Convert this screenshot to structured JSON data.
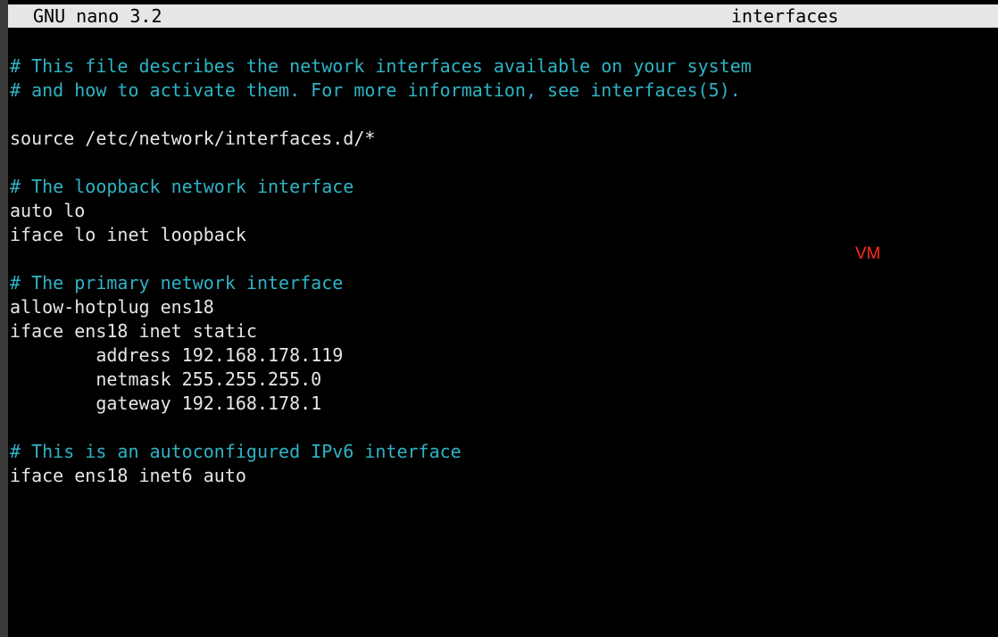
{
  "editor": {
    "app_version": "GNU nano 3.2",
    "file_name": "interfaces"
  },
  "buffer": {
    "lines": [
      {
        "text": "# This file describes the network interfaces available on your system",
        "kind": "comment"
      },
      {
        "text": "# and how to activate them. For more information, see interfaces(5).",
        "kind": "comment"
      },
      {
        "text": "",
        "kind": "code"
      },
      {
        "text": "source /etc/network/interfaces.d/*",
        "kind": "code"
      },
      {
        "text": "",
        "kind": "code"
      },
      {
        "text": "# The loopback network interface",
        "kind": "comment"
      },
      {
        "text": "auto lo",
        "kind": "code"
      },
      {
        "text": "iface lo inet loopback",
        "kind": "code"
      },
      {
        "text": "",
        "kind": "code"
      },
      {
        "text": "# The primary network interface",
        "kind": "comment"
      },
      {
        "text": "allow-hotplug ens18",
        "kind": "code"
      },
      {
        "text": "iface ens18 inet static",
        "kind": "code"
      },
      {
        "text": "        address 192.168.178.119",
        "kind": "code"
      },
      {
        "text": "        netmask 255.255.255.0",
        "kind": "code"
      },
      {
        "text": "        gateway 192.168.178.1",
        "kind": "code"
      },
      {
        "text": "",
        "kind": "code"
      },
      {
        "text": "# This is an autoconfigured IPv6 interface",
        "kind": "comment"
      },
      {
        "text": "iface ens18 inet6 auto",
        "kind": "code"
      }
    ]
  },
  "overlay": {
    "label": "VM"
  },
  "colors": {
    "title_bar_bg": "#e6e6e6",
    "comment": "#2fb3c4",
    "code": "#e6e6e6",
    "overlay_label": "#ff2a1a"
  }
}
